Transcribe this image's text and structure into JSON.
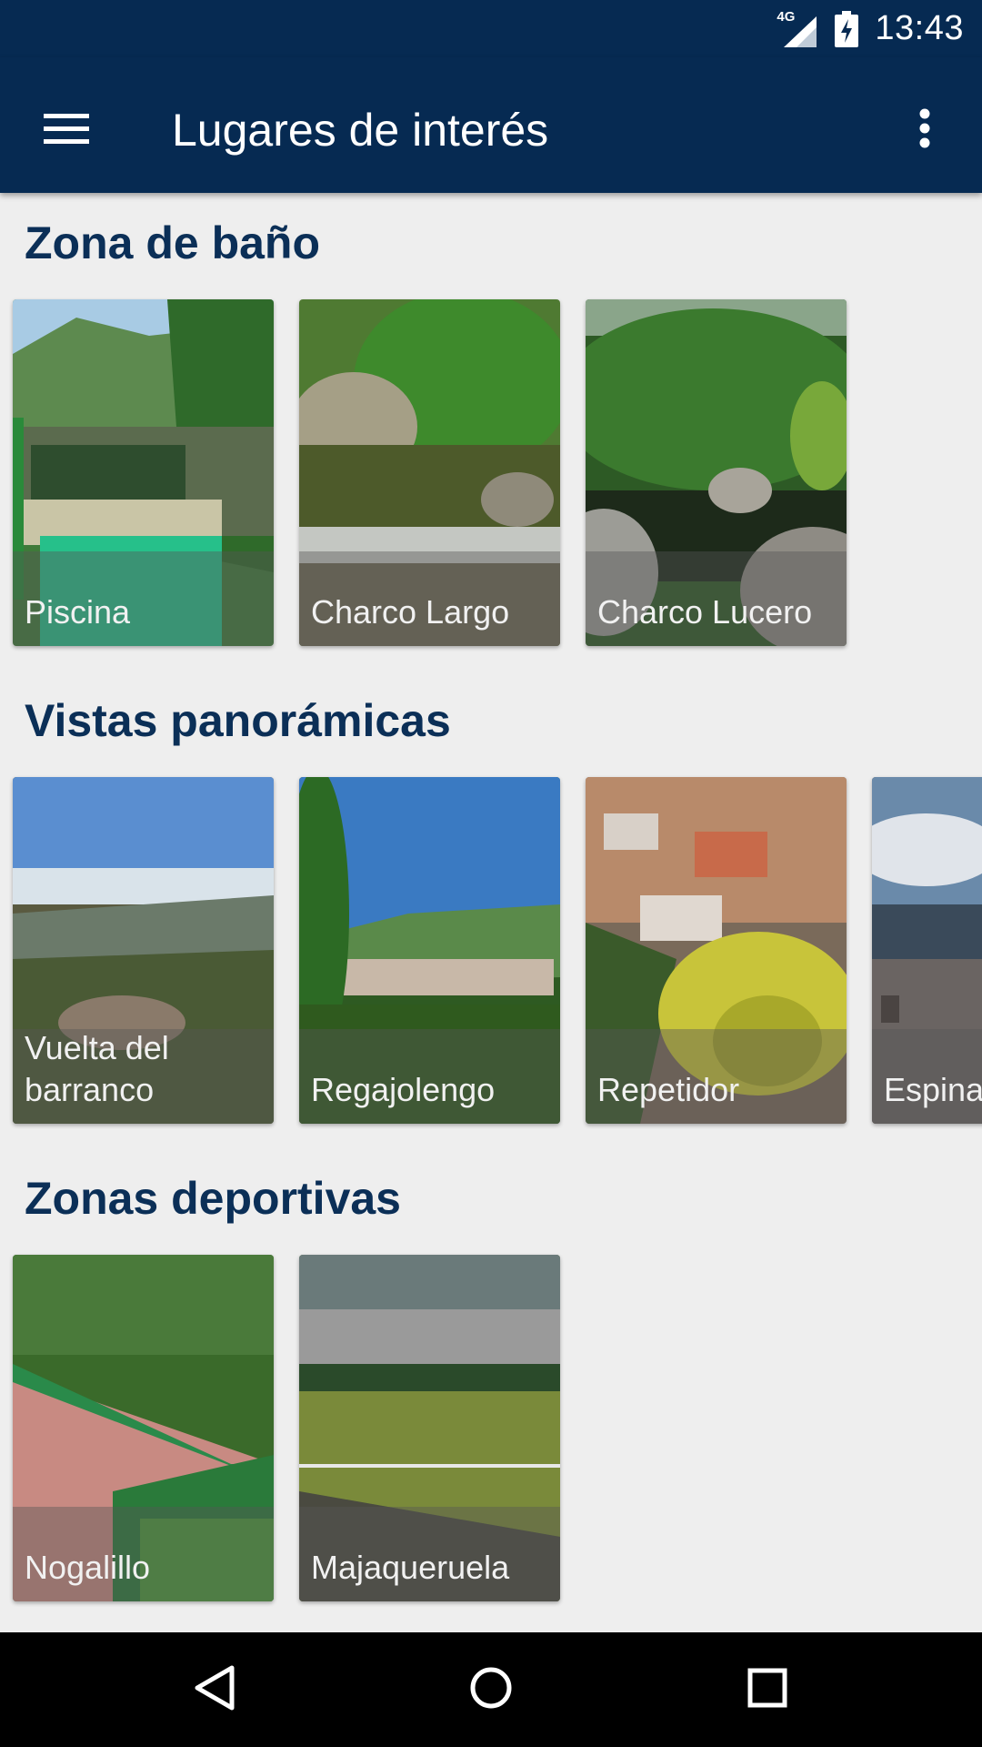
{
  "status_bar": {
    "network": "4G",
    "time": "13:43",
    "icons": [
      "signal-icon",
      "battery-charging-icon"
    ]
  },
  "app_bar": {
    "title": "Lugares de interés",
    "menu_icon": "hamburger-menu-icon",
    "overflow_icon": "more-vert-icon"
  },
  "sections": [
    {
      "title": "Zona de baño",
      "cards": [
        {
          "label": "Piscina"
        },
        {
          "label": "Charco Largo"
        },
        {
          "label": "Charco Lucero"
        }
      ]
    },
    {
      "title": "Vistas panorámicas",
      "cards": [
        {
          "label": "Vuelta del barranco"
        },
        {
          "label": "Regajolengo"
        },
        {
          "label": "Repetidor"
        },
        {
          "label": "Espina"
        }
      ]
    },
    {
      "title": "Zonas deportivas",
      "cards": [
        {
          "label": "Nogalillo"
        },
        {
          "label": "Majaqueruela"
        }
      ]
    }
  ],
  "nav_bar": {
    "icons": [
      "back-icon",
      "home-icon",
      "recents-icon"
    ]
  }
}
